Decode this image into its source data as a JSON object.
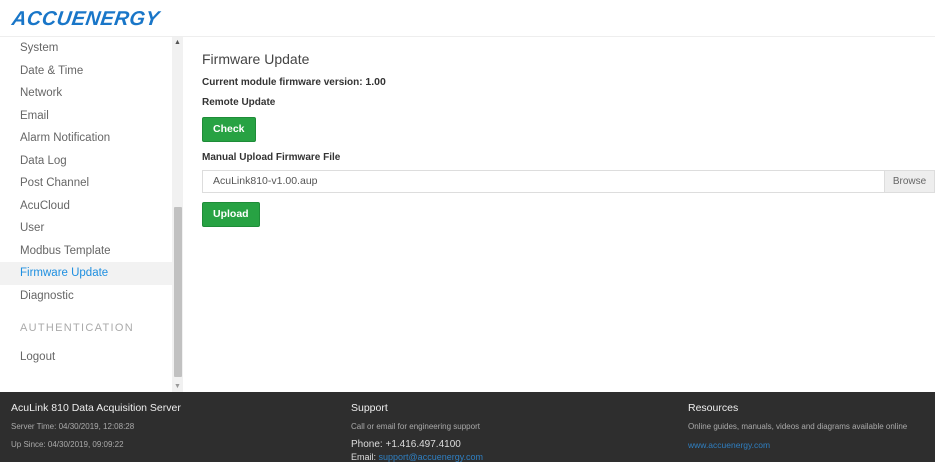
{
  "header": {
    "logo_text": "ACCUENERGY"
  },
  "sidebar": {
    "items": [
      {
        "label": "System"
      },
      {
        "label": "Date & Time"
      },
      {
        "label": "Network"
      },
      {
        "label": "Email"
      },
      {
        "label": "Alarm Notification"
      },
      {
        "label": "Data Log"
      },
      {
        "label": "Post Channel"
      },
      {
        "label": "AcuCloud"
      },
      {
        "label": "User"
      },
      {
        "label": "Modbus Template"
      },
      {
        "label": "Firmware Update",
        "active": true
      },
      {
        "label": "Diagnostic"
      }
    ],
    "section_heading": "AUTHENTICATION",
    "logout_label": "Logout"
  },
  "main": {
    "title": "Firmware Update",
    "current_version_label": "Current module firmware version:",
    "current_version_value": "1.00",
    "remote_update_label": "Remote Update",
    "check_button": "Check",
    "manual_upload_label": "Manual Upload Firmware File",
    "file_name": "AcuLink810-v1.00.aup",
    "browse_button": "Browse",
    "upload_button": "Upload"
  },
  "footer": {
    "col1": {
      "title": "AcuLink 810 Data Acquisition Server",
      "server_time": "Server Time: 04/30/2019, 12:08:28",
      "up_since": "Up Since: 04/30/2019, 09:09:22"
    },
    "col2": {
      "title": "Support",
      "subtitle": "Call or email for engineering support",
      "phone": "Phone: +1.416.497.4100",
      "email_label": "Email:",
      "email_value": "support@accuenergy.com"
    },
    "col3": {
      "title": "Resources",
      "subtitle": "Online guides, manuals, videos and diagrams available online",
      "link": "www.accuenergy.com"
    }
  },
  "colors": {
    "accent_green": "#27a243",
    "active_blue": "#1e8fe0",
    "footer_bg": "#2e2e2e",
    "logo_blue": "#1976c8"
  }
}
